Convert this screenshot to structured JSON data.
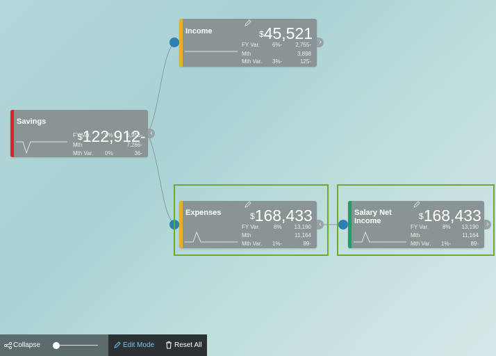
{
  "nodes": {
    "savings": {
      "title": "Savings",
      "currency": "$",
      "value": "122,912-",
      "rows": [
        {
          "label": "FY Var.",
          "pct": "0%",
          "num": "5,955-"
        },
        {
          "label": "Mth",
          "pct": "",
          "num": "7,266-"
        },
        {
          "label": "Mth Var.",
          "pct": "0%",
          "num": "36-"
        }
      ],
      "stripe_color": "#d8262a"
    },
    "income": {
      "title": "Income",
      "currency": "$",
      "value": "45,521",
      "rows": [
        {
          "label": "FY Var.",
          "pct": "6%-",
          "num": "2,755-"
        },
        {
          "label": "Mth",
          "pct": "",
          "num": "3,898"
        },
        {
          "label": "Mth Var.",
          "pct": "3%-",
          "num": "125-"
        }
      ],
      "stripe_color": "#e0b12b"
    },
    "expenses": {
      "title": "Expenses",
      "currency": "$",
      "value": "168,433",
      "rows": [
        {
          "label": "FY Var.",
          "pct": "8%",
          "num": "13,190"
        },
        {
          "label": "Mth",
          "pct": "",
          "num": "11,164"
        },
        {
          "label": "Mth Var.",
          "pct": "1%-",
          "num": "89-"
        }
      ],
      "stripe_color": "#e0b12b"
    },
    "salary": {
      "title": "Salary Net Income",
      "currency": "$",
      "value": "168,433",
      "rows": [
        {
          "label": "FY Var.",
          "pct": "8%",
          "num": "13,190"
        },
        {
          "label": "Mth",
          "pct": "",
          "num": "11,164"
        },
        {
          "label": "Mth Var.",
          "pct": "1%-",
          "num": "89-"
        }
      ],
      "stripe_color": "#1f9e6a"
    }
  },
  "toolbar": {
    "collapse_label": "Collapse",
    "edit_mode_label": "Edit Mode",
    "reset_all_label": "Reset All"
  },
  "colors": {
    "node_bg": "#8a9495",
    "connector_dot": "#2b7fb4",
    "highlight_border": "#6aaa2e"
  },
  "icons": [
    "share-icon",
    "pencil-icon",
    "edit-icon",
    "trash-icon",
    "chevron-left-icon",
    "chevron-right-icon"
  ]
}
